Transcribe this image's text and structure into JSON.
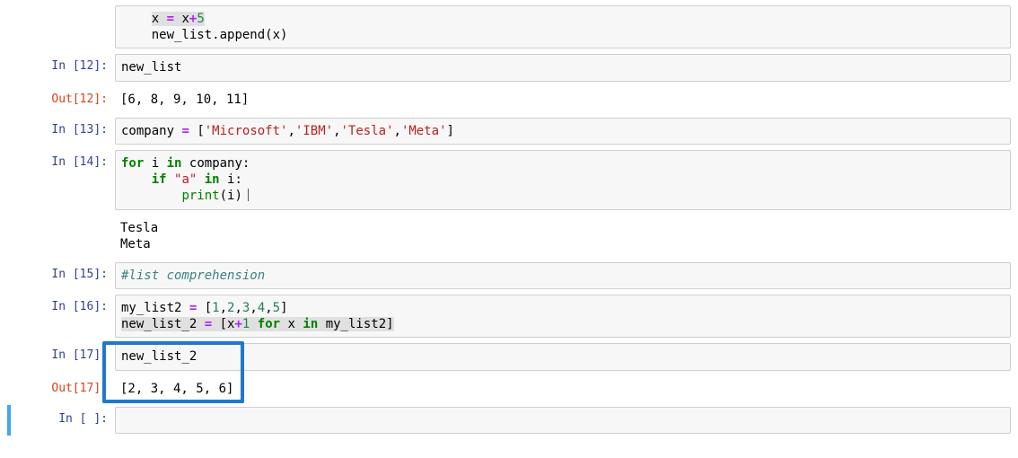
{
  "cells": {
    "c0": {
      "type": "code-fragment",
      "in_prompt": "",
      "lines": [
        {
          "indent": "    ",
          "hl": true,
          "tokens": [
            {
              "t": "x",
              "c": "tok-name"
            },
            {
              "t": " ",
              "c": ""
            },
            {
              "t": "=",
              "c": "tok-op"
            },
            {
              "t": " ",
              "c": ""
            },
            {
              "t": "x",
              "c": "tok-name"
            },
            {
              "t": "+",
              "c": "tok-op"
            },
            {
              "t": "5",
              "c": "tok-num"
            }
          ],
          "raw": "    x = x+5"
        },
        {
          "indent": "    ",
          "tokens": [
            {
              "t": "new_list",
              "c": "tok-name"
            },
            {
              "t": ".",
              "c": ""
            },
            {
              "t": "append",
              "c": "tok-name"
            },
            {
              "t": "(",
              "c": ""
            },
            {
              "t": "x",
              "c": "tok-name"
            },
            {
              "t": ")",
              "c": ""
            }
          ],
          "raw": "    new_list.append(x)"
        }
      ],
      "output": null
    },
    "c12": {
      "in_prompt": "In [12]:",
      "out_prompt": "Out[12]:",
      "lines": [
        {
          "tokens": [
            {
              "t": "new_list",
              "c": "tok-name"
            }
          ],
          "raw": "new_list"
        }
      ],
      "output": "[6, 8, 9, 10, 11]"
    },
    "c13": {
      "in_prompt": "In [13]:",
      "lines": [
        {
          "tokens": [
            {
              "t": "company",
              "c": "tok-name"
            },
            {
              "t": " ",
              "c": ""
            },
            {
              "t": "=",
              "c": "tok-op"
            },
            {
              "t": " [",
              "c": ""
            },
            {
              "t": "'Microsoft'",
              "c": "tok-str"
            },
            {
              "t": ",",
              "c": ""
            },
            {
              "t": "'IBM'",
              "c": "tok-str"
            },
            {
              "t": ",",
              "c": ""
            },
            {
              "t": "'Tesla'",
              "c": "tok-str"
            },
            {
              "t": ",",
              "c": ""
            },
            {
              "t": "'Meta'",
              "c": "tok-str"
            },
            {
              "t": "]",
              "c": ""
            }
          ],
          "raw": "company = ['Microsoft','IBM','Tesla','Meta']"
        }
      ],
      "output": null
    },
    "c14": {
      "in_prompt": "In [14]:",
      "lines": [
        {
          "tokens": [
            {
              "t": "for",
              "c": "tok-kw"
            },
            {
              "t": " ",
              "c": ""
            },
            {
              "t": "i",
              "c": "tok-name"
            },
            {
              "t": " ",
              "c": ""
            },
            {
              "t": "in",
              "c": "tok-kw"
            },
            {
              "t": " ",
              "c": ""
            },
            {
              "t": "company",
              "c": "tok-name"
            },
            {
              "t": ":",
              "c": ""
            }
          ],
          "raw": "for i in company:"
        },
        {
          "indent": "    ",
          "tokens": [
            {
              "t": "if",
              "c": "tok-kw"
            },
            {
              "t": " ",
              "c": ""
            },
            {
              "t": "\"a\"",
              "c": "tok-str"
            },
            {
              "t": " ",
              "c": ""
            },
            {
              "t": "in",
              "c": "tok-kw"
            },
            {
              "t": " ",
              "c": ""
            },
            {
              "t": "i",
              "c": "tok-name"
            },
            {
              "t": ":",
              "c": ""
            }
          ],
          "raw": "    if \"a\" in i:"
        },
        {
          "indent": "        ",
          "tokens": [
            {
              "t": "print",
              "c": "tok-builtin"
            },
            {
              "t": "(",
              "c": ""
            },
            {
              "t": "i",
              "c": "tok-name"
            },
            {
              "t": ")",
              "c": ""
            }
          ],
          "cursor": true,
          "raw": "        print(i)"
        }
      ],
      "stream": "Tesla\nMeta"
    },
    "c15": {
      "in_prompt": "In [15]:",
      "lines": [
        {
          "tokens": [
            {
              "t": "#list comprehension",
              "c": "tok-comment"
            }
          ],
          "raw": "#list comprehension"
        }
      ]
    },
    "c16": {
      "in_prompt": "In [16]:",
      "lines": [
        {
          "tokens": [
            {
              "t": "my_list2",
              "c": "tok-name"
            },
            {
              "t": " ",
              "c": ""
            },
            {
              "t": "=",
              "c": "tok-op"
            },
            {
              "t": " [",
              "c": ""
            },
            {
              "t": "1",
              "c": "tok-num"
            },
            {
              "t": ",",
              "c": ""
            },
            {
              "t": "2",
              "c": "tok-num"
            },
            {
              "t": ",",
              "c": ""
            },
            {
              "t": "3",
              "c": "tok-num"
            },
            {
              "t": ",",
              "c": ""
            },
            {
              "t": "4",
              "c": "tok-num"
            },
            {
              "t": ",",
              "c": ""
            },
            {
              "t": "5",
              "c": "tok-num"
            },
            {
              "t": "]",
              "c": ""
            }
          ],
          "raw": "my_list2 = [1,2,3,4,5]"
        },
        {
          "hl": true,
          "tokens": [
            {
              "t": "new_list_2",
              "c": "tok-name"
            },
            {
              "t": " ",
              "c": ""
            },
            {
              "t": "=",
              "c": "tok-op"
            },
            {
              "t": " [",
              "c": ""
            },
            {
              "t": "x",
              "c": "tok-name"
            },
            {
              "t": "+",
              "c": "tok-op"
            },
            {
              "t": "1",
              "c": "tok-num"
            },
            {
              "t": " ",
              "c": ""
            },
            {
              "t": "for",
              "c": "tok-kw"
            },
            {
              "t": " ",
              "c": ""
            },
            {
              "t": "x",
              "c": "tok-name"
            },
            {
              "t": " ",
              "c": ""
            },
            {
              "t": "in",
              "c": "tok-kw"
            },
            {
              "t": " ",
              "c": ""
            },
            {
              "t": "my_list2",
              "c": "tok-name"
            },
            {
              "t": "]",
              "c": ""
            }
          ],
          "raw": "new_list_2 = [x+1 for x in my_list2]"
        }
      ]
    },
    "c17": {
      "in_prompt": "In [17]:",
      "out_prompt": "Out[17]:",
      "lines": [
        {
          "tokens": [
            {
              "t": "new_list_2",
              "c": "tok-name"
            }
          ],
          "raw": "new_list_2"
        }
      ],
      "output": "[2, 3, 4, 5, 6]",
      "annotated": true
    },
    "cEmpty": {
      "in_prompt": "In [ ]:",
      "lines": [
        {
          "tokens": [
            {
              "t": " ",
              "c": ""
            }
          ],
          "raw": ""
        }
      ],
      "current": true
    }
  },
  "order": [
    "c0",
    "c12",
    "c13",
    "c14",
    "c15",
    "c16",
    "c17",
    "cEmpty"
  ]
}
